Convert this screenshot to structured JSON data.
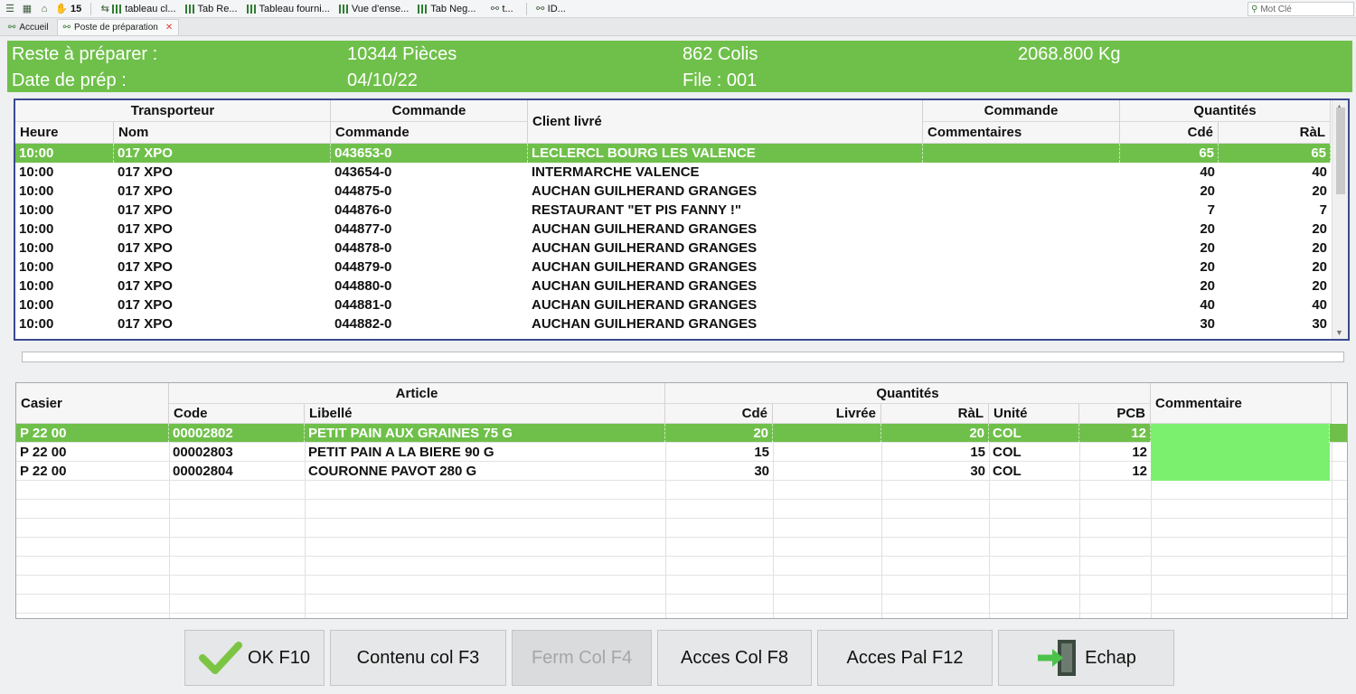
{
  "toolbar": {
    "count": "15",
    "items": [
      "tableau cl...",
      "Tab Re...",
      "Tableau fourni...",
      "Vue d'ense...",
      "Tab Neg...",
      "t...",
      "ID..."
    ],
    "search_placeholder": "Mot Clé"
  },
  "tabs": [
    {
      "label": "Accueil",
      "active": false
    },
    {
      "label": "Poste de préparation",
      "active": true
    }
  ],
  "header": {
    "reste_label": "Reste à préparer :",
    "pieces": "10344 Pièces",
    "colis": "862 Colis",
    "poids": "2068.800 Kg",
    "date_label": "Date de prép :",
    "date_value": "04/10/22",
    "file": "File : 001"
  },
  "orders": {
    "group_headers": {
      "transporteur": "Transporteur",
      "commande": "Commande",
      "client": "Client livré",
      "commande2": "Commande",
      "quantites": "Quantités"
    },
    "columns": {
      "heure": "Heure",
      "nom": "Nom",
      "commande": "Commande",
      "commentaires": "Commentaires",
      "cde": "Cdé",
      "ral": "RàL"
    },
    "rows": [
      {
        "heure": "10:00",
        "nom": "017 XPO",
        "commande": "043653-0",
        "client": "LECLERCL BOURG LES VALENCE",
        "comm": "",
        "cde": "65",
        "ral": "65"
      },
      {
        "heure": "10:00",
        "nom": "017 XPO",
        "commande": "043654-0",
        "client": "INTERMARCHE VALENCE",
        "comm": "",
        "cde": "40",
        "ral": "40"
      },
      {
        "heure": "10:00",
        "nom": "017 XPO",
        "commande": "044875-0",
        "client": "AUCHAN GUILHERAND GRANGES",
        "comm": "",
        "cde": "20",
        "ral": "20"
      },
      {
        "heure": "10:00",
        "nom": "017 XPO",
        "commande": "044876-0",
        "client": "RESTAURANT \"ET PIS FANNY !\"",
        "comm": "",
        "cde": "7",
        "ral": "7"
      },
      {
        "heure": "10:00",
        "nom": "017 XPO",
        "commande": "044877-0",
        "client": "AUCHAN GUILHERAND GRANGES",
        "comm": "",
        "cde": "20",
        "ral": "20"
      },
      {
        "heure": "10:00",
        "nom": "017 XPO",
        "commande": "044878-0",
        "client": "AUCHAN GUILHERAND GRANGES",
        "comm": "",
        "cde": "20",
        "ral": "20"
      },
      {
        "heure": "10:00",
        "nom": "017 XPO",
        "commande": "044879-0",
        "client": "AUCHAN GUILHERAND GRANGES",
        "comm": "",
        "cde": "20",
        "ral": "20"
      },
      {
        "heure": "10:00",
        "nom": "017 XPO",
        "commande": "044880-0",
        "client": "AUCHAN GUILHERAND GRANGES",
        "comm": "",
        "cde": "20",
        "ral": "20"
      },
      {
        "heure": "10:00",
        "nom": "017 XPO",
        "commande": "044881-0",
        "client": "AUCHAN GUILHERAND GRANGES",
        "comm": "",
        "cde": "40",
        "ral": "40"
      },
      {
        "heure": "10:00",
        "nom": "017 XPO",
        "commande": "044882-0",
        "client": "AUCHAN GUILHERAND GRANGES",
        "comm": "",
        "cde": "30",
        "ral": "30"
      }
    ]
  },
  "articles": {
    "group_headers": {
      "casier": "Casier",
      "article": "Article",
      "quantites": "Quantités",
      "commentaire": "Commentaire"
    },
    "columns": {
      "code": "Code",
      "libelle": "Libellé",
      "cde": "Cdé",
      "livree": "Livrée",
      "ral": "RàL",
      "unite": "Unité",
      "pcb": "PCB"
    },
    "rows": [
      {
        "casier": "P 22 00",
        "code": "00002802",
        "libelle": "PETIT PAIN AUX GRAINES 75 G",
        "cde": "20",
        "livree": "",
        "ral": "20",
        "unite": "COL",
        "pcb": "12"
      },
      {
        "casier": "P 22 00",
        "code": "00002803",
        "libelle": "PETIT PAIN A LA BIERE 90 G",
        "cde": "15",
        "livree": "",
        "ral": "15",
        "unite": "COL",
        "pcb": "12"
      },
      {
        "casier": "P 22 00",
        "code": "00002804",
        "libelle": "COURONNE PAVOT 280 G",
        "cde": "30",
        "livree": "",
        "ral": "30",
        "unite": "COL",
        "pcb": "12"
      }
    ]
  },
  "buttons": {
    "ok": "OK F10",
    "contenu": "Contenu col F3",
    "ferm": "Ferm Col F4",
    "acces_col": "Acces Col F8",
    "acces_pal": "Acces Pal F12",
    "echap": "Echap"
  },
  "colors": {
    "accent_green": "#6fc04a",
    "comment_green": "#7bf06e",
    "grid_border": "#3b4b8f"
  }
}
